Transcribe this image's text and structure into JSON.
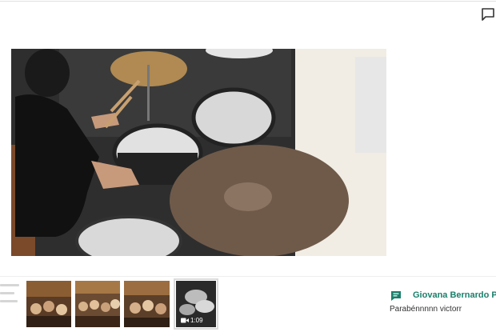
{
  "header": {
    "comment_icon": "comment-icon"
  },
  "viewer": {
    "media_type": "video",
    "subject": "drum-kit"
  },
  "thumbnails": [
    {
      "kind": "photo",
      "icon": "photo-thumbnail"
    },
    {
      "kind": "photo",
      "icon": "photo-thumbnail"
    },
    {
      "kind": "photo",
      "icon": "photo-thumbnail"
    },
    {
      "kind": "video",
      "icon": "video-camera-icon",
      "duration": "1:09",
      "selected": true
    }
  ],
  "comment": {
    "icon": "comment-icon",
    "author": "Giovana Bernardo Pa",
    "text": "Parabénnnnn victorr"
  },
  "colors": {
    "accent": "#1a7f6b",
    "comment_icon": "#1a7f6b"
  }
}
